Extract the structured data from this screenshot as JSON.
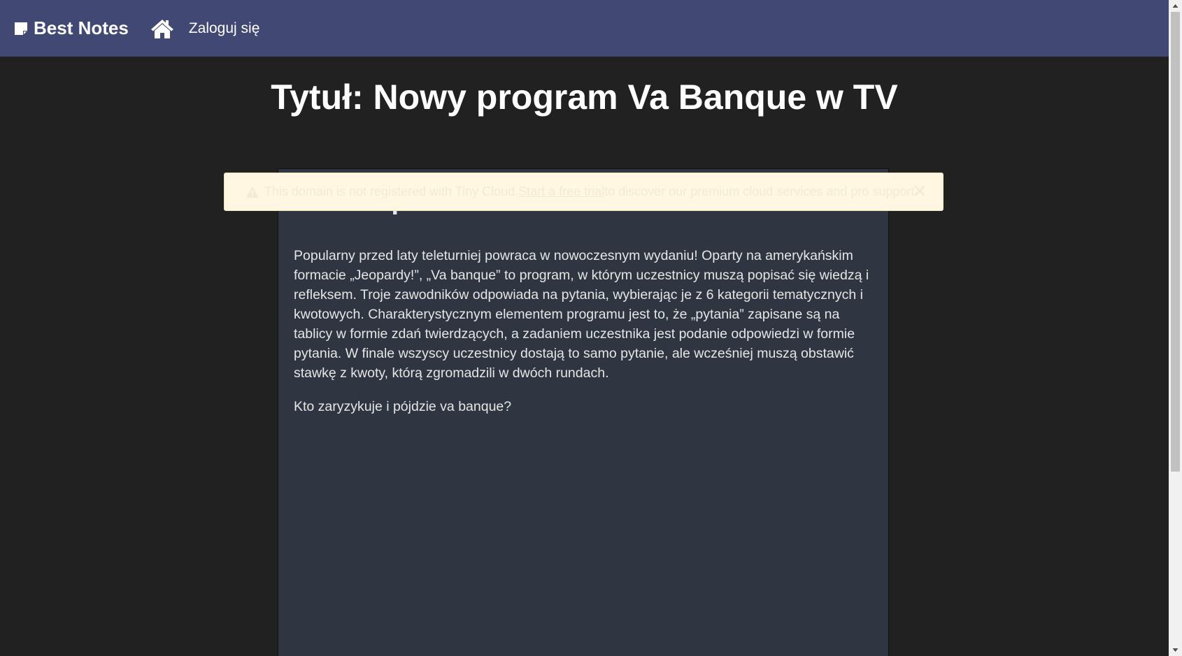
{
  "navbar": {
    "brand_label": "Best Notes",
    "brand_icon": "sticky-note-icon",
    "home_icon": "home-icon",
    "login_label": "Zaloguj się",
    "background": "#414873"
  },
  "page": {
    "title": "Tytuł: Nowy program Va Banque w TV"
  },
  "editor": {
    "heading": "Va Banque",
    "paragraphs": [
      "Popularny przed laty teleturniej powraca w nowoczesnym wydaniu! Oparty na amerykańskim formacie „Jeopardy!”, „Va banque” to program, w którym uczestnicy muszą popisać się wiedzą i refleksem. Troje zawodników odpowiada na pytania, wybierając je z 6 kategorii tematycznych i kwotowych. Charakterystycznym elementem programu jest to, że „pytania” zapisane są na tablicy w formie zdań twierdzących, a zadaniem uczestnika jest podanie odpowiedzi w formie pytania. W finale wszyscy uczestnicy dostają to samo pytanie, ale wcześniej muszą obstawić stawkę z kwoty, którą zgromadzili w dwóch rundach.",
      "Kto zaryzykuje i pójdzie va banque?"
    ]
  },
  "notice": {
    "icon": "warning-icon",
    "text_before": "This domain is not registered with Tiny Cloud. ",
    "link_label": "Start a free trial",
    "text_after": " to discover our premium cloud services and pro support.",
    "close_icon": "close-icon"
  },
  "scrollbar": {
    "up_icon": "scroll-up-arrow-icon",
    "down_icon": "scroll-down-arrow-icon"
  }
}
